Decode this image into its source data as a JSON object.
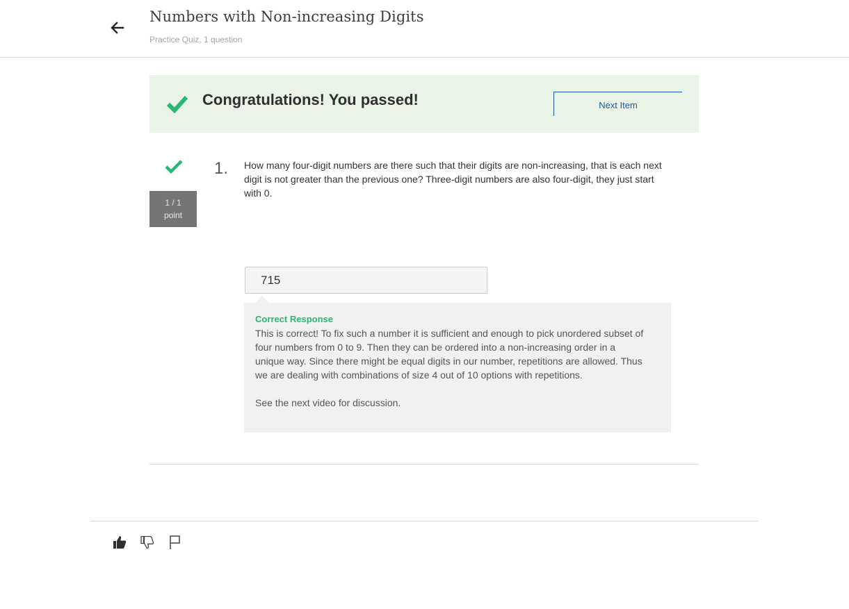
{
  "header": {
    "title": "Numbers with Non-increasing Digits",
    "subtitle": "Practice Quiz, 1 question"
  },
  "banner": {
    "message": "Congratulations! You passed!",
    "next_item_label": "Next Item"
  },
  "question": {
    "number": "1.",
    "text": "How many four-digit numbers are there such that their digits are non-increasing, that is each next digit is not greater than the previous one? Three-digit numbers are also four-digit, they just start with 0.",
    "points_score": "1 / 1",
    "points_label": "point",
    "answer_value": "715"
  },
  "feedback": {
    "label": "Correct Response",
    "body": "This is correct! To fix such a number it is sufficient and enough to pick unordered subset of four numbers from 0 to 9. Then they can be ordered into a non-increasing order in a unique way. Since there might be equal digits in our number, repetitions are allowed. Thus we are dealing with combinations of size 4 out of 10 options with repetitions.",
    "follow_up": "See the next video for discussion."
  },
  "footer": {
    "icons": [
      "thumbs-up-icon",
      "thumbs-down-icon",
      "flag-icon"
    ]
  },
  "colors": {
    "success_green": "#2bb673",
    "banner_bg": "#e9f3e6",
    "link_blue": "#1f5aa6",
    "points_bg": "#757575"
  }
}
